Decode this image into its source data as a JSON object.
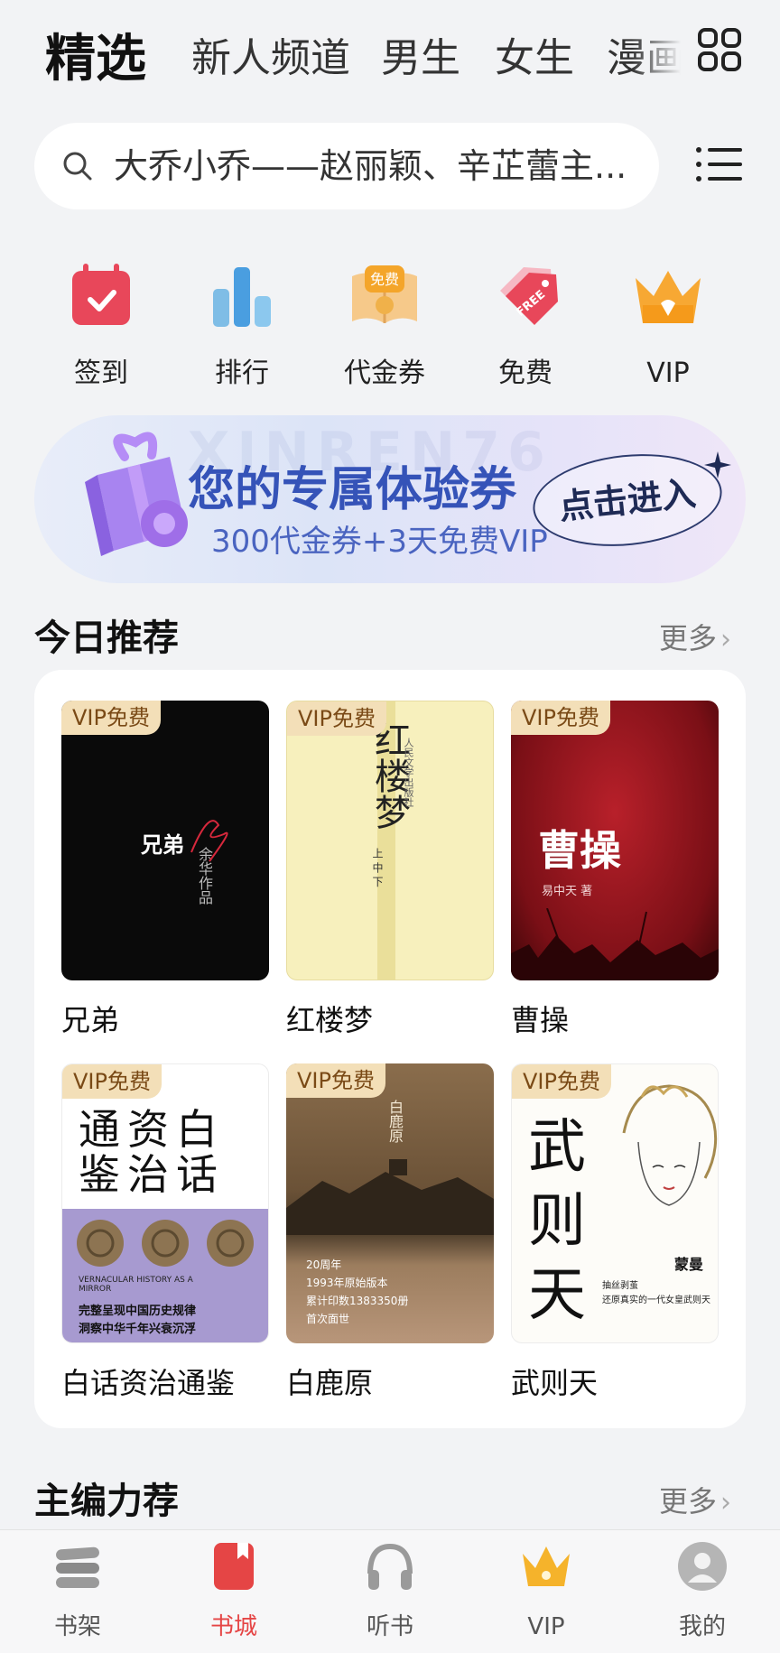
{
  "top_tabs": [
    "精选",
    "新人频道",
    "男生",
    "女生",
    "漫画"
  ],
  "search": {
    "placeholder": "大乔小乔——赵丽颖、辛芷蕾主..."
  },
  "quick_entries": [
    {
      "label": "签到",
      "icon": "calendar-check-icon"
    },
    {
      "label": "排行",
      "icon": "bar-chart-icon"
    },
    {
      "label": "代金券",
      "icon": "coupon-book-icon"
    },
    {
      "label": "免费",
      "icon": "free-tag-icon"
    },
    {
      "label": "VIP",
      "icon": "crown-icon"
    }
  ],
  "banner": {
    "title": "您的专属体验券",
    "subtitle": "300代金券+3天免费VIP",
    "cta": "点击进入",
    "watermark": "XINREN76"
  },
  "today": {
    "title": "今日推荐",
    "more": "更多",
    "badge": "VIP免费",
    "books": [
      {
        "title": "兄弟",
        "cover_text": [
          "兄弟",
          "余华作品",
          "余华"
        ]
      },
      {
        "title": "红楼梦",
        "cover_text": [
          "红楼梦",
          "上 中 下",
          "人民文学出版社"
        ]
      },
      {
        "title": "曹操",
        "cover_text": [
          "曹操",
          "易中天 著"
        ]
      },
      {
        "title": "白话资治通鉴",
        "cover_text": [
          "白资通",
          "话治鉴",
          "VERNACULAR HISTORY AS A MIRROR",
          "完整呈现中国历史规律",
          "洞察中华千年兴衰沉浮"
        ]
      },
      {
        "title": "白鹿原",
        "cover_text": [
          "白鹿原",
          "20周年",
          "1993年原始版本",
          "累计印数1383350册",
          "首次面世"
        ]
      },
      {
        "title": "武则天",
        "cover_text": [
          "武",
          "则",
          "天",
          "蒙曼",
          "抽丝剥茧",
          "还原真实的一代女皇武则天"
        ]
      }
    ]
  },
  "editor": {
    "title": "主编力荐",
    "more": "更多"
  },
  "bottom_nav": [
    {
      "label": "书架",
      "icon": "bookshelf-icon"
    },
    {
      "label": "书城",
      "icon": "bookstore-icon"
    },
    {
      "label": "听书",
      "icon": "headphones-icon"
    },
    {
      "label": "VIP",
      "icon": "crown-icon"
    },
    {
      "label": "我的",
      "icon": "user-avatar-icon"
    }
  ],
  "colors": {
    "active_tab": "#e54545",
    "vip_badge_bg": "#f3dfb8",
    "vip_badge_text": "#7a4a16",
    "banner_title": "#3553b8"
  }
}
